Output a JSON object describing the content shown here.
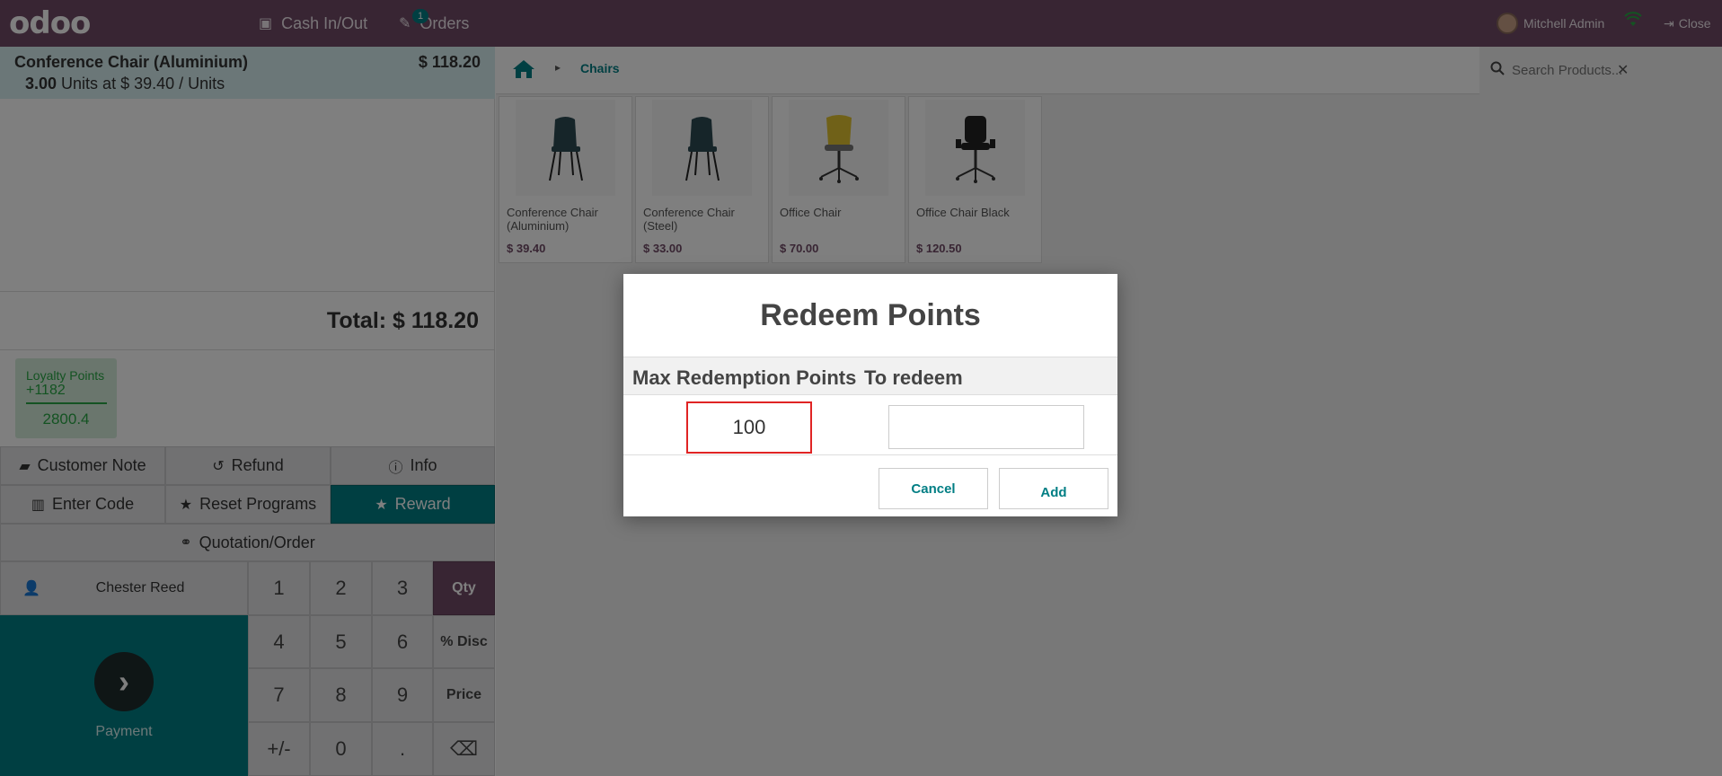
{
  "navbar": {
    "logo": "odoo",
    "cash_label": "Cash In/Out",
    "orders_label": "Orders",
    "orders_badge": "1",
    "user_name": "Mitchell Admin",
    "close_label": "Close"
  },
  "order": {
    "line_name": "Conference Chair (Aluminium)",
    "line_price": "$ 118.20",
    "line_qty": "3.00",
    "line_detail": " Units at $ 39.40 / Units",
    "total": "Total: $ 118.20"
  },
  "loyalty": {
    "title": "Loyalty Points",
    "gained": "+1182",
    "balance": "2800.4"
  },
  "controls": {
    "customer_note": "Customer Note",
    "refund": "Refund",
    "info": "Info",
    "enter_code": "Enter Code",
    "reset_programs": "Reset Programs",
    "reward": "Reward",
    "quotation": "Quotation/Order"
  },
  "customer": {
    "name": "Chester Reed"
  },
  "payment": {
    "label": "Payment"
  },
  "numpad": {
    "k1": "1",
    "k2": "2",
    "k3": "3",
    "qty": "Qty",
    "k4": "4",
    "k5": "5",
    "k6": "6",
    "disc": "% Disc",
    "k7": "7",
    "k8": "8",
    "k9": "9",
    "price": "Price",
    "plusminus": "+/-",
    "k0": "0",
    "dot": ".",
    "backspace": "⌫"
  },
  "breadcrumb": {
    "category": "Chairs"
  },
  "search": {
    "placeholder": "Search Products..."
  },
  "products": [
    {
      "name": "Conference Chair (Aluminium)",
      "price": "$ 39.40"
    },
    {
      "name": "Conference Chair (Steel)",
      "price": "$ 33.00"
    },
    {
      "name": "Office Chair",
      "price": "$ 70.00"
    },
    {
      "name": "Office Chair Black",
      "price": "$ 120.50"
    }
  ],
  "modal": {
    "title": "Redeem Points",
    "col_max": "Max Redemption Points",
    "col_redeem": "To redeem",
    "max_value": "100",
    "redeem_value": "",
    "cancel": "Cancel",
    "add": "Add"
  },
  "colors": {
    "brand": "#714b67",
    "accent": "#017e84",
    "loyalty": "#28a745",
    "highlight": "#e02424"
  }
}
